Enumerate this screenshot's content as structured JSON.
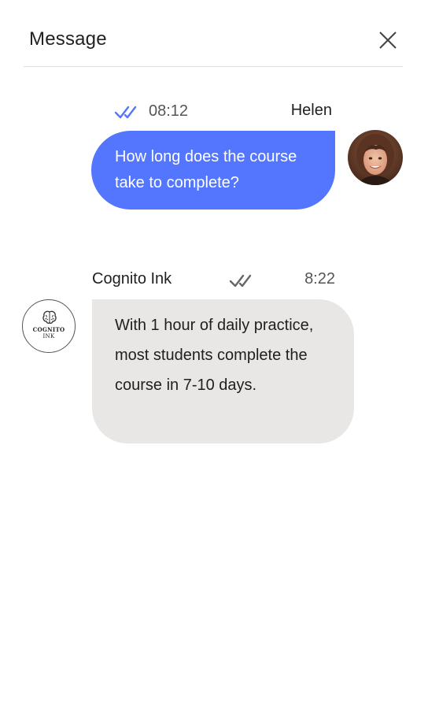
{
  "header": {
    "title": "Message",
    "close_icon": "close-icon"
  },
  "messages": [
    {
      "direction": "outgoing",
      "sender": "Helen",
      "time": "08:12",
      "status_icon": "double-check-icon",
      "status_color": "#5476ff",
      "text": "How long does the course take to complete?",
      "bubble_color": "#5476ff",
      "avatar": "helen-avatar-photo"
    },
    {
      "direction": "incoming",
      "sender": "Cognito Ink",
      "time": "8:22",
      "status_icon": "double-check-icon",
      "status_color": "#666666",
      "text": "With 1 hour of daily practice, most students complete the course in 7-10 days.",
      "bubble_color": "#e8e7e5",
      "avatar": {
        "icon": "brain-icon",
        "logo_line1": "COGNITO",
        "logo_line2": "INK"
      }
    }
  ]
}
